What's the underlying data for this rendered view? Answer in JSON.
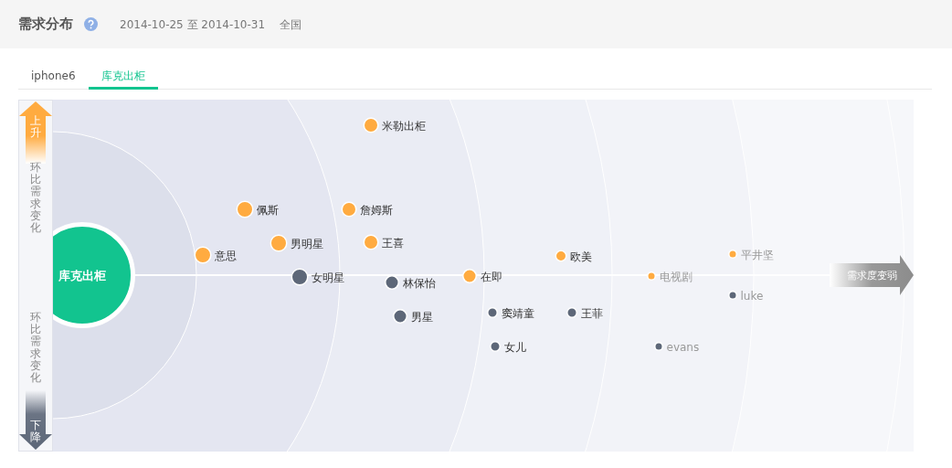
{
  "header": {
    "title": "需求分布",
    "date_range": "2014-10-25 至 2014-10-31",
    "region": "全国"
  },
  "tabs": [
    {
      "label": "iphone6",
      "selected": false
    },
    {
      "label": "库克出柜",
      "selected": true
    }
  ],
  "chart": {
    "center": "库克出柜",
    "up_label": "上升",
    "up_axis": "环比需求变化",
    "down_axis": "环比需求变化",
    "down_label": "下降",
    "weaker_label": "需求度变弱",
    "terms": [
      {
        "label": "米勒出柜",
        "color": "#ffab40"
      },
      {
        "label": "佩斯",
        "color": "#ffab40"
      },
      {
        "label": "詹姆斯",
        "color": "#ffab40"
      },
      {
        "label": "意思",
        "color": "#ffab40"
      },
      {
        "label": "男明星",
        "color": "#ffab40"
      },
      {
        "label": "王喜",
        "color": "#ffab40"
      },
      {
        "label": "女明星",
        "color": "#5d6778"
      },
      {
        "label": "林保怡",
        "color": "#5d6778"
      },
      {
        "label": "在即",
        "color": "#ffab40"
      },
      {
        "label": "欧美",
        "color": "#ffab40"
      },
      {
        "label": "男星",
        "color": "#5d6778"
      },
      {
        "label": "窦靖童",
        "color": "#5d6778"
      },
      {
        "label": "王菲",
        "color": "#5d6778"
      },
      {
        "label": "女儿",
        "color": "#5d6778"
      },
      {
        "label": "电视剧",
        "color": "#ffab40"
      },
      {
        "label": "平井坚",
        "color": "#ffab40"
      },
      {
        "label": "luke",
        "color": "#5d6778"
      },
      {
        "label": "evans",
        "color": "#5d6778"
      }
    ]
  }
}
